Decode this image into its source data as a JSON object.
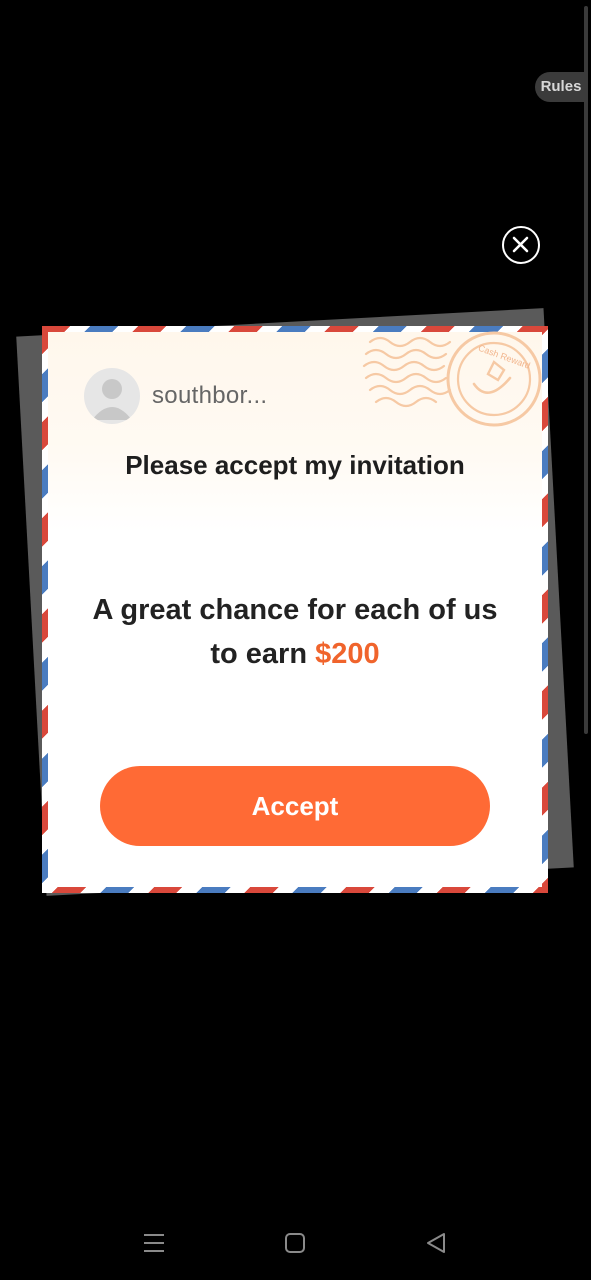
{
  "header": {
    "rules_label": "Rules"
  },
  "invitation": {
    "username": "southbor...",
    "title": "Please accept my invitation",
    "message_prefix": "A great chance for each of us to earn",
    "amount": "$200",
    "accept_label": "Accept",
    "stamp_text": "Cash Reward"
  },
  "colors": {
    "accent": "#ff6a35",
    "amount": "#f0642c",
    "stripe_red": "#d9483b",
    "stripe_blue": "#4a7cc0",
    "background": "#000000"
  },
  "icons": {
    "close": "close-icon",
    "avatar": "avatar-placeholder-icon",
    "nav_menu": "menu-icon",
    "nav_home": "home-icon",
    "nav_back": "back-icon"
  }
}
